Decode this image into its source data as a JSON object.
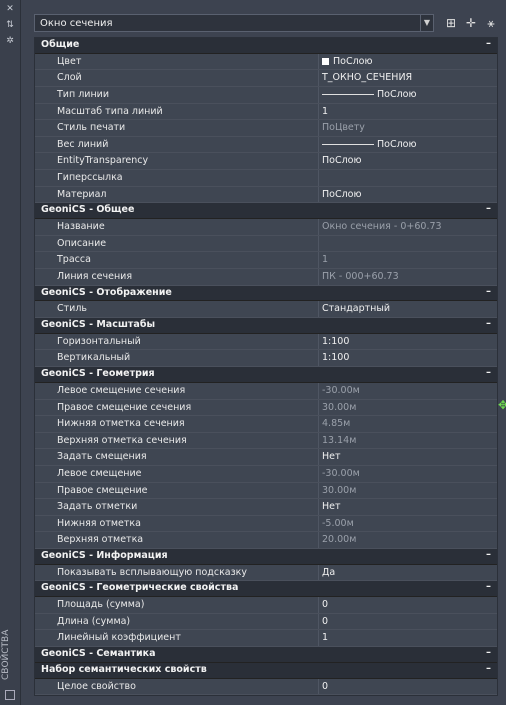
{
  "panel": {
    "side_title": "СВОЙСТВА"
  },
  "selector": {
    "value": "Окно сечения"
  },
  "sections": [
    {
      "title": "Общие",
      "toggle": "–",
      "rows": [
        {
          "label": "Цвет",
          "value": "ПоСлою",
          "swatch": true
        },
        {
          "label": "Слой",
          "value": "Т_ОКНО_СЕЧЕНИЯ"
        },
        {
          "label": "Тип линии",
          "value": "ПоСлою",
          "line": true
        },
        {
          "label": "Масштаб типа линий",
          "value": "1"
        },
        {
          "label": "Стиль печати",
          "value": "ПоЦвету",
          "grey": true
        },
        {
          "label": "Вес линий",
          "value": "ПоСлою",
          "line": true
        },
        {
          "label": "EntityTransparency",
          "value": "ПоСлою"
        },
        {
          "label": "Гиперссылка",
          "value": ""
        },
        {
          "label": "Материал",
          "value": "ПоСлою"
        }
      ]
    },
    {
      "title": "GeoniCS - Общее",
      "toggle": "–",
      "rows": [
        {
          "label": "Название",
          "value": "Окно сечения - 0+60.73",
          "grey": true
        },
        {
          "label": "Описание",
          "value": ""
        },
        {
          "label": "Трасса",
          "value": "1",
          "grey": true
        },
        {
          "label": "Линия сечения",
          "value": "ПК - 000+60.73",
          "grey": true
        }
      ]
    },
    {
      "title": "GeoniCS - Отображение",
      "toggle": "–",
      "rows": [
        {
          "label": "Стиль",
          "value": "Стандартный"
        }
      ]
    },
    {
      "title": "GeoniCS - Масштабы",
      "toggle": "–",
      "rows": [
        {
          "label": "Горизонтальный",
          "value": "1:100"
        },
        {
          "label": "Вертикальный",
          "value": "1:100"
        }
      ]
    },
    {
      "title": "GeoniCS - Геометрия",
      "toggle": "–",
      "rows": [
        {
          "label": "Левое смещение сечения",
          "value": "-30.00м",
          "grey": true
        },
        {
          "label": "Правое смещение сечения",
          "value": "30.00м",
          "grey": true
        },
        {
          "label": "Нижняя отметка сечения",
          "value": "4.85м",
          "grey": true
        },
        {
          "label": "Верхняя отметка сечения",
          "value": "13.14м",
          "grey": true
        },
        {
          "label": "Задать смещения",
          "value": "Нет"
        },
        {
          "label": "Левое смещение",
          "value": "-30.00м",
          "grey": true
        },
        {
          "label": "Правое смещение",
          "value": "30.00м",
          "grey": true
        },
        {
          "label": "Задать отметки",
          "value": "Нет"
        },
        {
          "label": "Нижняя отметка",
          "value": "-5.00м",
          "grey": true
        },
        {
          "label": "Верхняя отметка",
          "value": "20.00м",
          "grey": true
        }
      ]
    },
    {
      "title": "GeoniCS - Информация",
      "toggle": "–",
      "rows": [
        {
          "label": "Показывать всплывающую подсказку",
          "value": "Да"
        }
      ]
    },
    {
      "title": "GeoniCS - Геометрические свойства",
      "toggle": "–",
      "rows": [
        {
          "label": "Площадь (сумма)",
          "value": "0"
        },
        {
          "label": "Длина (сумма)",
          "value": "0"
        },
        {
          "label": "Линейный коэффициент",
          "value": "1"
        }
      ]
    },
    {
      "title": "GeoniCS - Семантика",
      "toggle": "–",
      "rows": []
    },
    {
      "title": "Набор семантических свойств",
      "toggle": "–",
      "rows": [
        {
          "label": "Целое свойство",
          "value": "0"
        }
      ]
    }
  ]
}
